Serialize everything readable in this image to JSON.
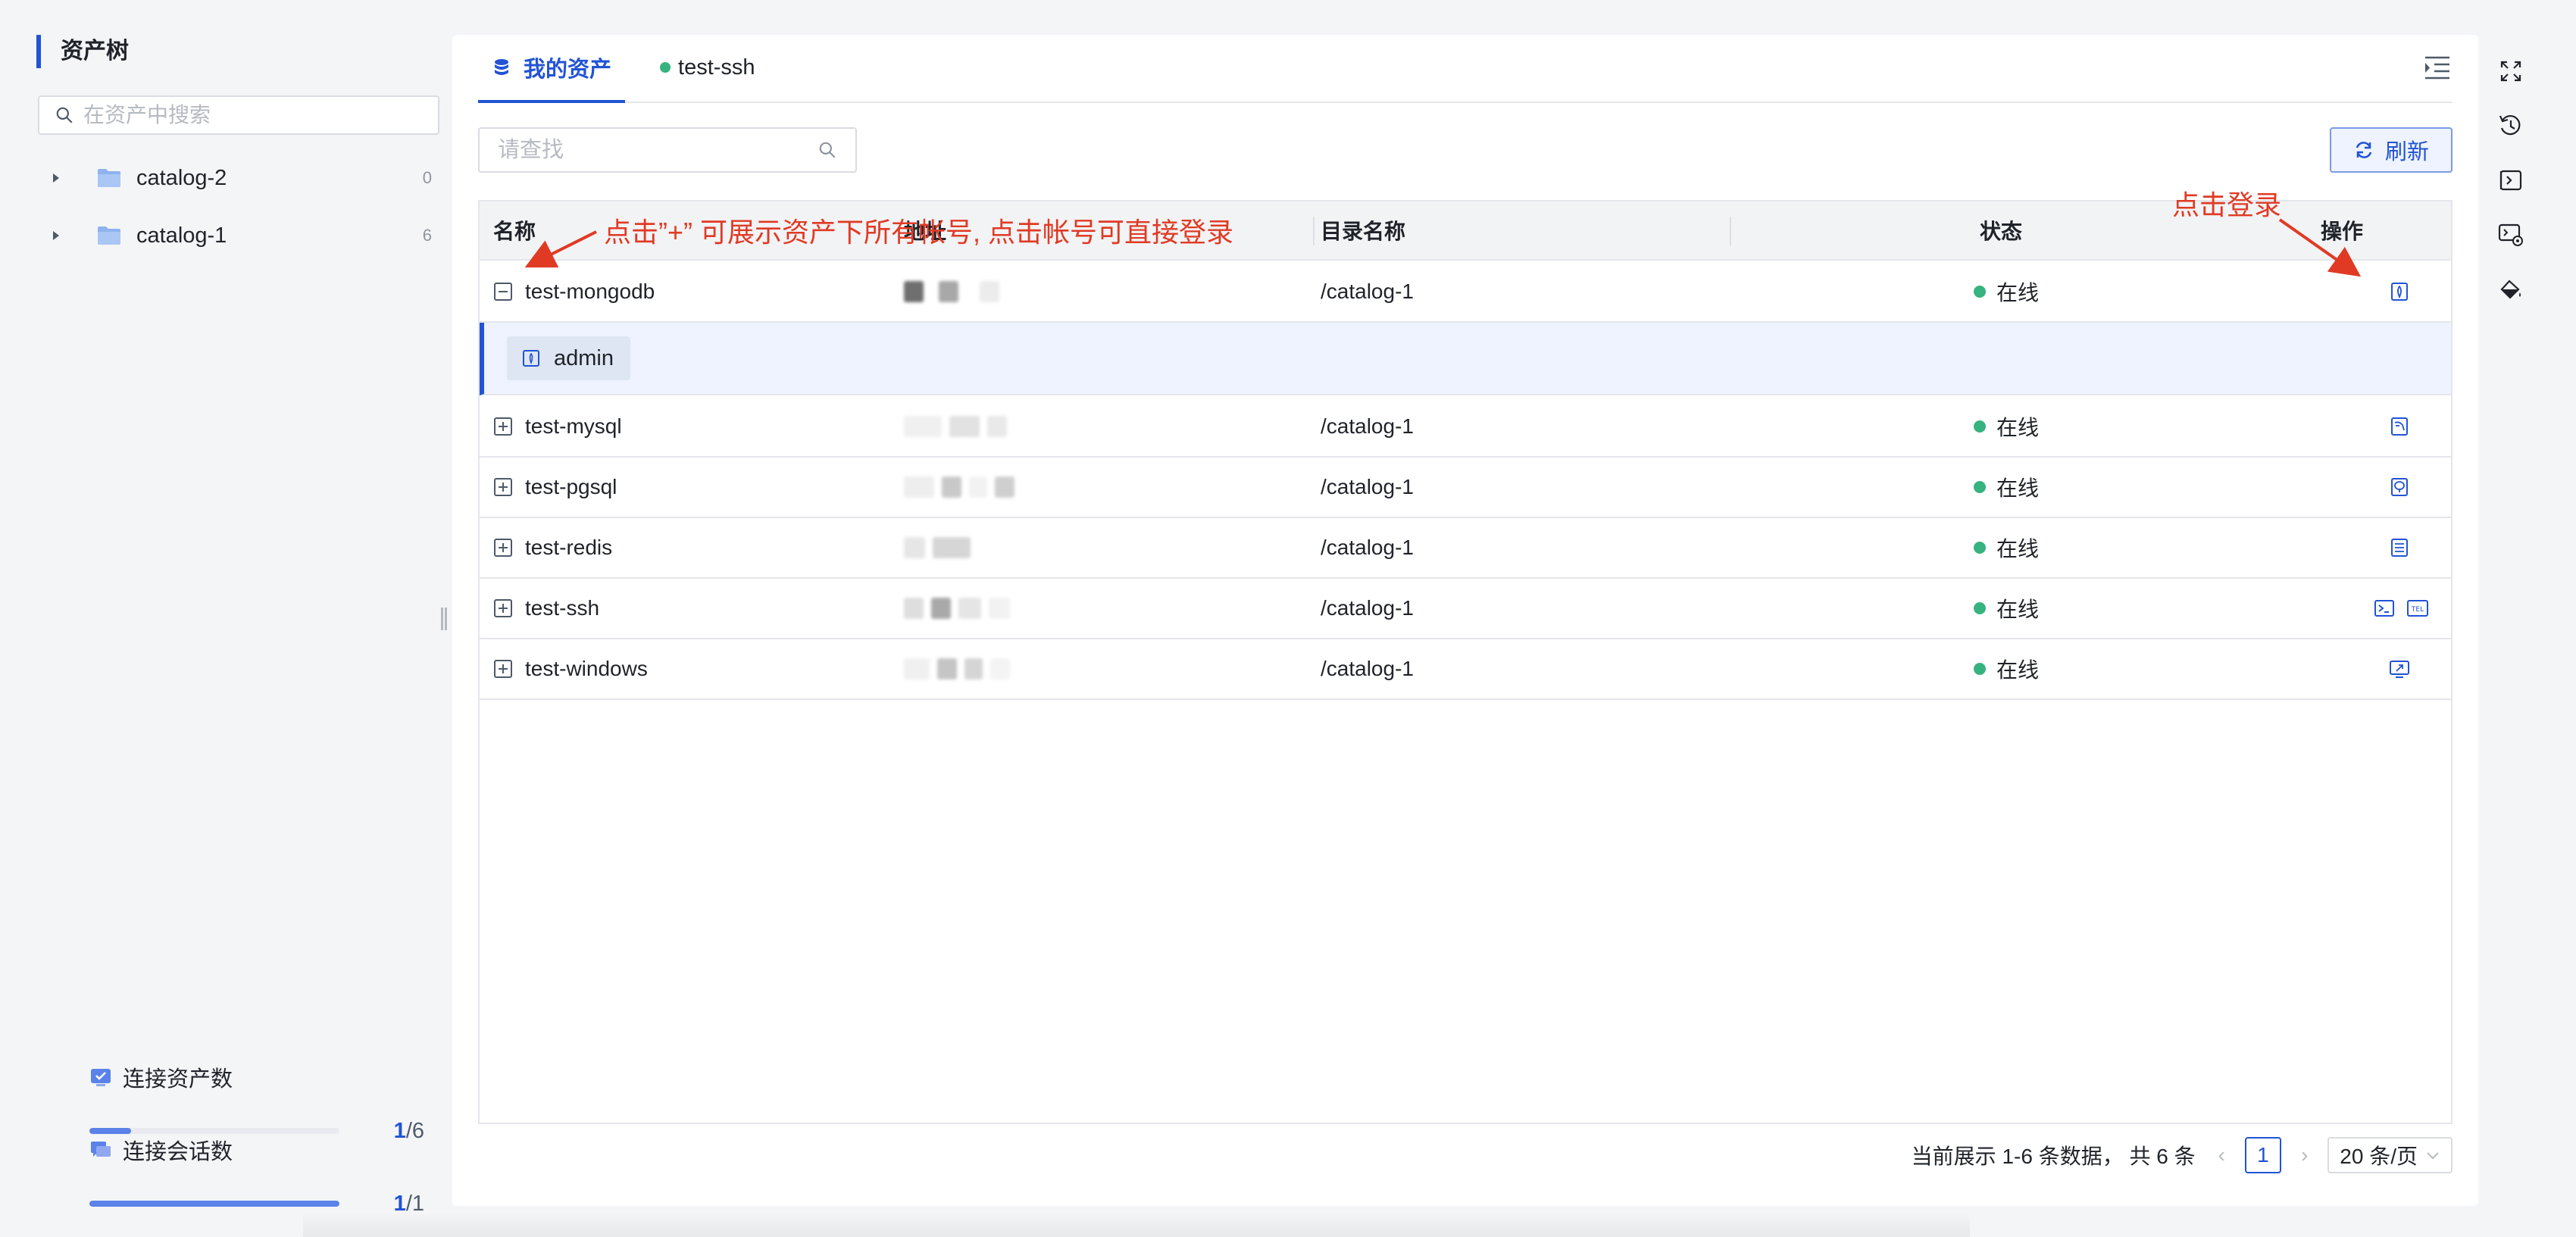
{
  "sidebar": {
    "title": "资产树",
    "search_placeholder": "在资产中搜索",
    "tree": [
      {
        "label": "catalog-2",
        "count": "0"
      },
      {
        "label": "catalog-1",
        "count": "6"
      }
    ],
    "stats": [
      {
        "label": "连接资产数",
        "current": "1",
        "total": "/6",
        "fraction": 0.167
      },
      {
        "label": "连接会话数",
        "current": "1",
        "total": "/1",
        "fraction": 1.0
      }
    ]
  },
  "tabs": [
    {
      "label": "我的资产",
      "icon": "database-icon",
      "active": true
    },
    {
      "label": "test-ssh",
      "icon": "online-dot",
      "active": false
    }
  ],
  "toolbar": {
    "search_placeholder": "请查找",
    "refresh_label": "刷新"
  },
  "table": {
    "headers": {
      "name": "名称",
      "address": "地址",
      "directory": "目录名称",
      "status": "状态",
      "operation": "操作"
    },
    "rows": [
      {
        "name": "test-mongodb",
        "directory": "/catalog-1",
        "status": "在线",
        "expanded": true,
        "op_icons": [
          "mongodb-connect-icon"
        ]
      },
      {
        "name": "test-mysql",
        "directory": "/catalog-1",
        "status": "在线",
        "expanded": false,
        "op_icons": [
          "mysql-connect-icon"
        ]
      },
      {
        "name": "test-pgsql",
        "directory": "/catalog-1",
        "status": "在线",
        "expanded": false,
        "op_icons": [
          "pgsql-connect-icon"
        ]
      },
      {
        "name": "test-redis",
        "directory": "/catalog-1",
        "status": "在线",
        "expanded": false,
        "op_icons": [
          "redis-connect-icon"
        ]
      },
      {
        "name": "test-ssh",
        "directory": "/catalog-1",
        "status": "在线",
        "expanded": false,
        "op_icons": [
          "terminal-icon",
          "telnet-icon"
        ]
      },
      {
        "name": "test-windows",
        "directory": "/catalog-1",
        "status": "在线",
        "expanded": false,
        "op_icons": [
          "rdp-icon"
        ]
      }
    ],
    "account": "admin"
  },
  "annotations": {
    "expand_hint": "点击”+” 可展示资产下所有帐号, 点击帐号可直接登录",
    "login_hint": "点击登录"
  },
  "pagination": {
    "summary": "当前展示 1-6 条数据，  共 6 条",
    "current_page": "1",
    "page_size": "20 条/页"
  },
  "colors": {
    "accent": "#2153d4",
    "online": "#36b37e",
    "annotation": "#e03a24"
  },
  "right_toolbar": [
    "fullscreen-icon",
    "history-icon",
    "command-icon",
    "screen-settings-icon",
    "theme-paint-icon"
  ]
}
